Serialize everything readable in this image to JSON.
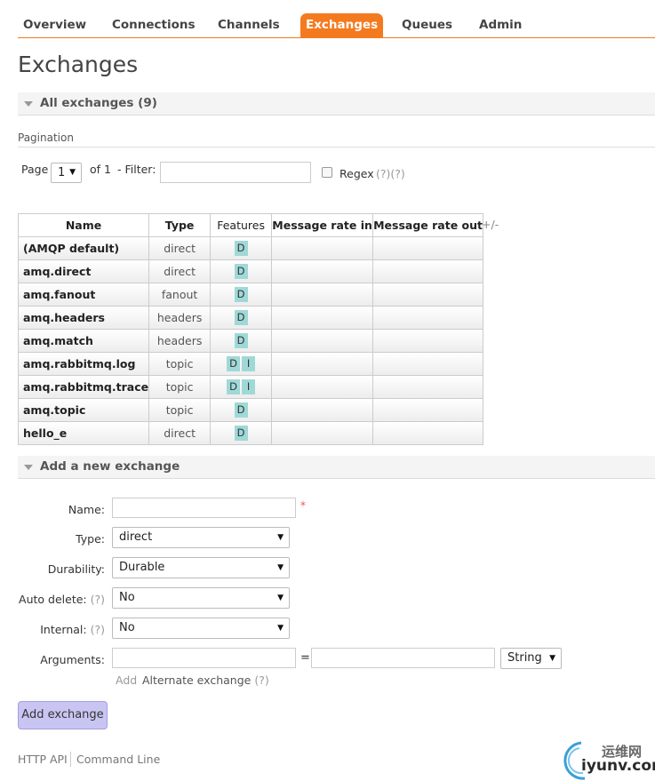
{
  "nav": {
    "items": [
      "Overview",
      "Connections",
      "Channels",
      "Exchanges",
      "Queues",
      "Admin"
    ],
    "active": "Exchanges"
  },
  "page_title": "Exchanges",
  "all_exchanges": {
    "label": "All exchanges (9)"
  },
  "pagination": {
    "label": "Pagination",
    "page_label": "Page",
    "page_value": "1",
    "of_label": "of 1",
    "filter_label": "- Filter:",
    "filter_value": "",
    "regex_label": "Regex",
    "regex_help": "(?)(?)"
  },
  "table": {
    "columns": [
      "Name",
      "Type",
      "Features",
      "Message rate in",
      "Message rate out"
    ],
    "toggle_label": "+/-",
    "rows": [
      {
        "name": "(AMQP default)",
        "type": "direct",
        "features": [
          "D"
        ]
      },
      {
        "name": "amq.direct",
        "type": "direct",
        "features": [
          "D"
        ]
      },
      {
        "name": "amq.fanout",
        "type": "fanout",
        "features": [
          "D"
        ]
      },
      {
        "name": "amq.headers",
        "type": "headers",
        "features": [
          "D"
        ]
      },
      {
        "name": "amq.match",
        "type": "headers",
        "features": [
          "D"
        ]
      },
      {
        "name": "amq.rabbitmq.log",
        "type": "topic",
        "features": [
          "D",
          "I"
        ]
      },
      {
        "name": "amq.rabbitmq.trace",
        "type": "topic",
        "features": [
          "D",
          "I"
        ]
      },
      {
        "name": "amq.topic",
        "type": "topic",
        "features": [
          "D"
        ]
      },
      {
        "name": "hello_e",
        "type": "direct",
        "features": [
          "D"
        ]
      }
    ]
  },
  "add_exchange": {
    "section_label": "Add a new exchange",
    "name_label": "Name:",
    "name_value": "",
    "required_mark": "*",
    "type_label": "Type:",
    "type_value": "direct",
    "durability_label": "Durability:",
    "durability_value": "Durable",
    "auto_delete_label": "Auto delete:",
    "auto_delete_help": "(?)",
    "auto_delete_value": "No",
    "internal_label": "Internal:",
    "internal_help": "(?)",
    "internal_value": "No",
    "arguments_label": "Arguments:",
    "arg_key": "",
    "arg_eq": "=",
    "arg_value": "",
    "arg_type": "String",
    "add_link": "Add",
    "alt_exchange_link": "Alternate exchange",
    "alt_exchange_help": "(?)",
    "submit_label": "Add exchange"
  },
  "footer": {
    "http_api": "HTTP API",
    "command_line": "Command Line"
  },
  "watermark": {
    "cn": "运维网",
    "en": "iyunv.com"
  },
  "colors": {
    "accent": "#f47a1f",
    "badge": "#9fd9d7",
    "button": "#c9c5f3"
  }
}
